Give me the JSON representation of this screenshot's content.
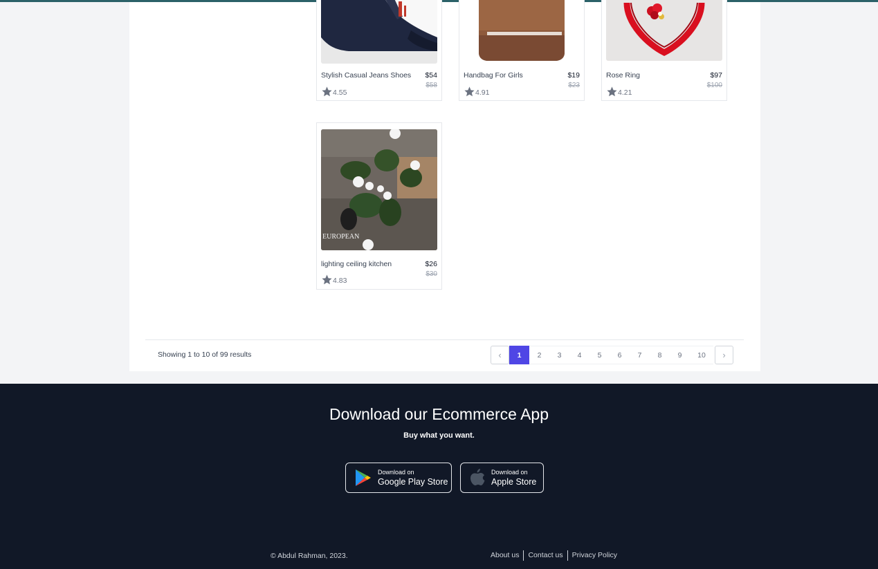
{
  "products": [
    {
      "name": "Stylish Casual Jeans Shoes",
      "price": "$54",
      "old_price": "$58",
      "rating": "4.55"
    },
    {
      "name": "Handbag For Girls",
      "price": "$19",
      "old_price": "$23",
      "rating": "4.91"
    },
    {
      "name": "Rose Ring",
      "price": "$97",
      "old_price": "$100",
      "rating": "4.21"
    },
    {
      "name": "lighting ceiling kitchen",
      "price": "$26",
      "old_price": "$30",
      "rating": "4.83"
    }
  ],
  "product_image_overlay": "EUROPEAN",
  "pagination": {
    "showing": "Showing 1 to 10 of 99 results",
    "pages": [
      "1",
      "2",
      "3",
      "4",
      "5",
      "6",
      "7",
      "8",
      "9",
      "10"
    ],
    "active": "1",
    "prev_icon": "chevron-left-icon",
    "next_icon": "chevron-right-icon"
  },
  "footer": {
    "title": "Download our Ecommerce App",
    "subtitle": "Buy what you want.",
    "google": {
      "small": "Download on",
      "big": "Google Play Store"
    },
    "apple": {
      "small": "Download on",
      "big": "Apple Store"
    },
    "copyright": "© Abdul Rahman, 2023.",
    "links": [
      "About us",
      "Contact us",
      "Privacy Policy"
    ]
  },
  "colors": {
    "accent": "#4f46e5",
    "footer_bg": "#111827",
    "page_bg": "#f3f4f6",
    "top_border": "#2b6168"
  }
}
